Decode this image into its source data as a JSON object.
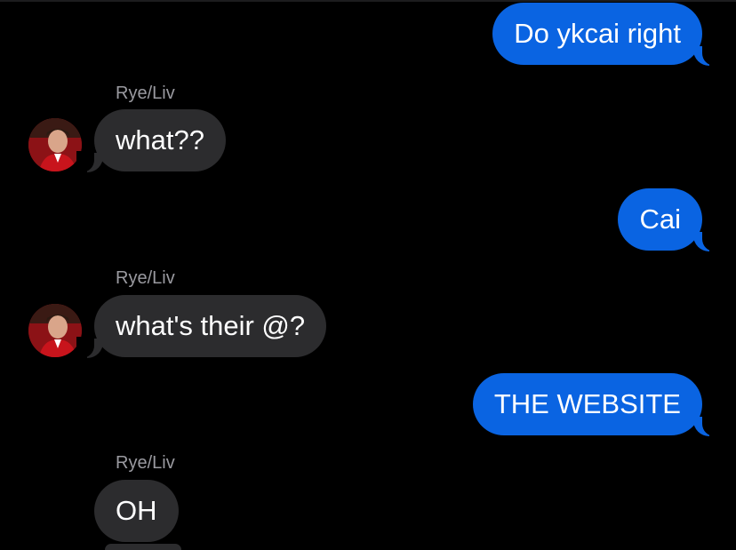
{
  "conversation": {
    "messages": [
      {
        "direction": "outgoing",
        "text": "Do ykcai right"
      },
      {
        "direction": "incoming",
        "sender": "Rye/Liv",
        "text": "what??"
      },
      {
        "direction": "outgoing",
        "text": "Cai"
      },
      {
        "direction": "incoming",
        "sender": "Rye/Liv",
        "text": "what's their @?"
      },
      {
        "direction": "outgoing",
        "text": "THE WEBSITE"
      },
      {
        "direction": "incoming",
        "sender": "Rye/Liv",
        "text": "OH"
      }
    ]
  },
  "colors": {
    "background": "#000000",
    "outgoing_bubble": "#0a64e2",
    "incoming_bubble": "#2c2c2e",
    "sender_name": "#9a9aa0"
  },
  "icons": {
    "avatar": "contact-avatar-photo"
  }
}
